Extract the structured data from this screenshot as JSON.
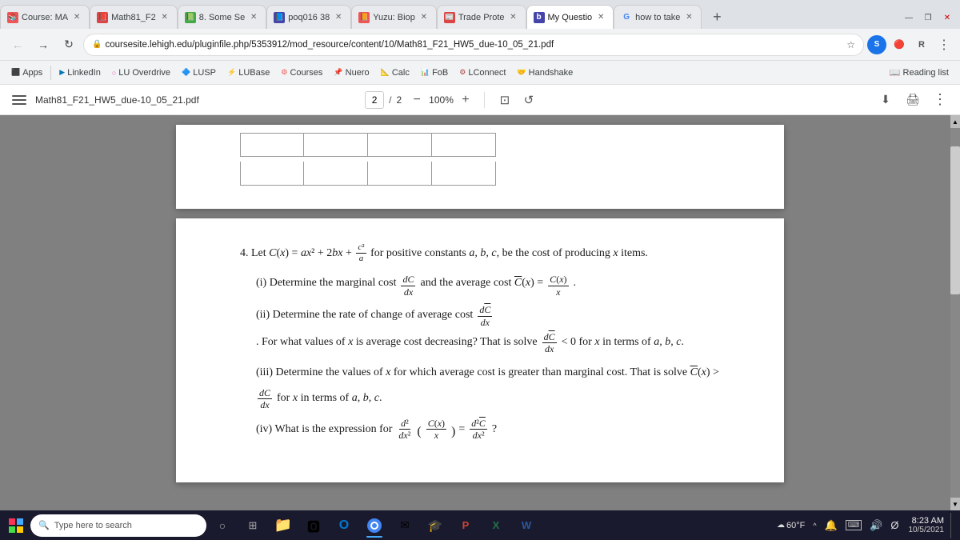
{
  "browser": {
    "tabs": [
      {
        "id": "course",
        "label": "Course: MA",
        "favicon": "📚",
        "favicon_color": "fav-orange",
        "active": false
      },
      {
        "id": "math81",
        "label": "Math81_F2",
        "favicon": "📕",
        "favicon_color": "fav-red",
        "active": false
      },
      {
        "id": "8some",
        "label": "8. Some Se",
        "favicon": "📗",
        "favicon_color": "fav-green",
        "active": false
      },
      {
        "id": "poq",
        "label": "poq016 38",
        "favicon": "📘",
        "favicon_color": "fav-blue",
        "active": false
      },
      {
        "id": "yuzu",
        "label": "Yuzu: Biop",
        "favicon": "📙",
        "favicon_color": "fav-orange",
        "active": false
      },
      {
        "id": "trade",
        "label": "Trade Prote",
        "favicon": "📰",
        "favicon_color": "fav-red",
        "active": false
      },
      {
        "id": "myq",
        "label": "My Questio",
        "favicon": "b",
        "favicon_color": "fav-blue",
        "active": true
      },
      {
        "id": "howtotake",
        "label": "how to take",
        "favicon": "G",
        "favicon_color": "fav-google",
        "active": false
      }
    ],
    "new_tab_label": "+",
    "address": "coursesite.lehigh.edu/pluginfile.php/5353912/mod_resource/content/10/Math81_F21_HW5_due-10_05_21.pdf",
    "address_protocol": "https://",
    "window_controls": [
      "—",
      "❐",
      "✕"
    ]
  },
  "bookmarks": [
    {
      "id": "apps",
      "label": "Apps",
      "favicon": "⬛"
    },
    {
      "id": "linkedin",
      "label": "LinkedIn",
      "favicon": "▶"
    },
    {
      "id": "luoverdrive",
      "label": "LU Overdrive",
      "favicon": "○"
    },
    {
      "id": "lusp",
      "label": "LUSP",
      "favicon": "🔷"
    },
    {
      "id": "lubase",
      "label": "LUBase",
      "favicon": "⚡"
    },
    {
      "id": "courses",
      "label": "Courses",
      "favicon": "⚙"
    },
    {
      "id": "nuero",
      "label": "Nuero",
      "favicon": "📌"
    },
    {
      "id": "calc",
      "label": "Calc",
      "favicon": "📐"
    },
    {
      "id": "fob",
      "label": "FoB",
      "favicon": "📊"
    },
    {
      "id": "lconnect",
      "label": "LConnect",
      "favicon": "⚙"
    },
    {
      "id": "handshake",
      "label": "Handshake",
      "favicon": "🤝"
    }
  ],
  "reading_list_label": "Reading list",
  "pdf": {
    "filename": "Math81_F21_HW5_due-10_05_21.pdf",
    "current_page": "2",
    "total_pages": "2",
    "zoom": "100%",
    "content": {
      "problem_4": {
        "statement": "4. Let C(x) = ax² + 2bx + c²/a for positive constants a, b, c, be the cost of producing x items.",
        "part_i": "(i) Determine the marginal cost dC/dx and the average cost C̄(x) = C(x)/x.",
        "part_ii": "(ii) Determine the rate of change of average cost dC̄/dx. For what values of x is average cost decreasing? That is solve dC̄/dx < 0 for x in terms of a, b, c.",
        "part_iii": "(iii) Determine the values of x for which average cost is greater than marginal cost. That is solve C̄(x) > dC/dx for x in terms of a, b, c.",
        "part_iv": "(iv) What is the expression for d²/dx²(C(x)/x) = d²C̄/dx²?"
      }
    }
  },
  "taskbar": {
    "search_placeholder": "Type here to search",
    "apps": [
      {
        "id": "cortana",
        "icon": "○",
        "label": "Cortana"
      },
      {
        "id": "taskview",
        "icon": "⊞",
        "label": "Task View"
      },
      {
        "id": "file-explorer",
        "icon": "📁",
        "label": "File Explorer"
      },
      {
        "id": "office",
        "icon": "🅾",
        "label": "Office"
      },
      {
        "id": "outlook",
        "icon": "📧",
        "label": "Outlook"
      },
      {
        "id": "chrome",
        "icon": "🌐",
        "label": "Chrome"
      },
      {
        "id": "mail",
        "icon": "✉",
        "label": "Mail"
      },
      {
        "id": "grad",
        "icon": "🎓",
        "label": "Graduate"
      },
      {
        "id": "ppt",
        "icon": "📊",
        "label": "PowerPoint"
      },
      {
        "id": "excel",
        "icon": "📗",
        "label": "Excel"
      },
      {
        "id": "word",
        "icon": "📘",
        "label": "Word"
      }
    ],
    "system": [
      {
        "id": "weather",
        "icon": "☁",
        "label": "60°F"
      },
      {
        "id": "chevron",
        "icon": "^",
        "label": ""
      },
      {
        "id": "notification",
        "icon": "🔔",
        "label": ""
      },
      {
        "id": "keyboard",
        "icon": "⌨",
        "label": ""
      },
      {
        "id": "volume",
        "icon": "🔊",
        "label": ""
      },
      {
        "id": "network",
        "icon": "Ø",
        "label": ""
      }
    ],
    "clock": {
      "time": "8:23 AM",
      "date": "10/5/2021"
    },
    "notification_label": "□"
  }
}
